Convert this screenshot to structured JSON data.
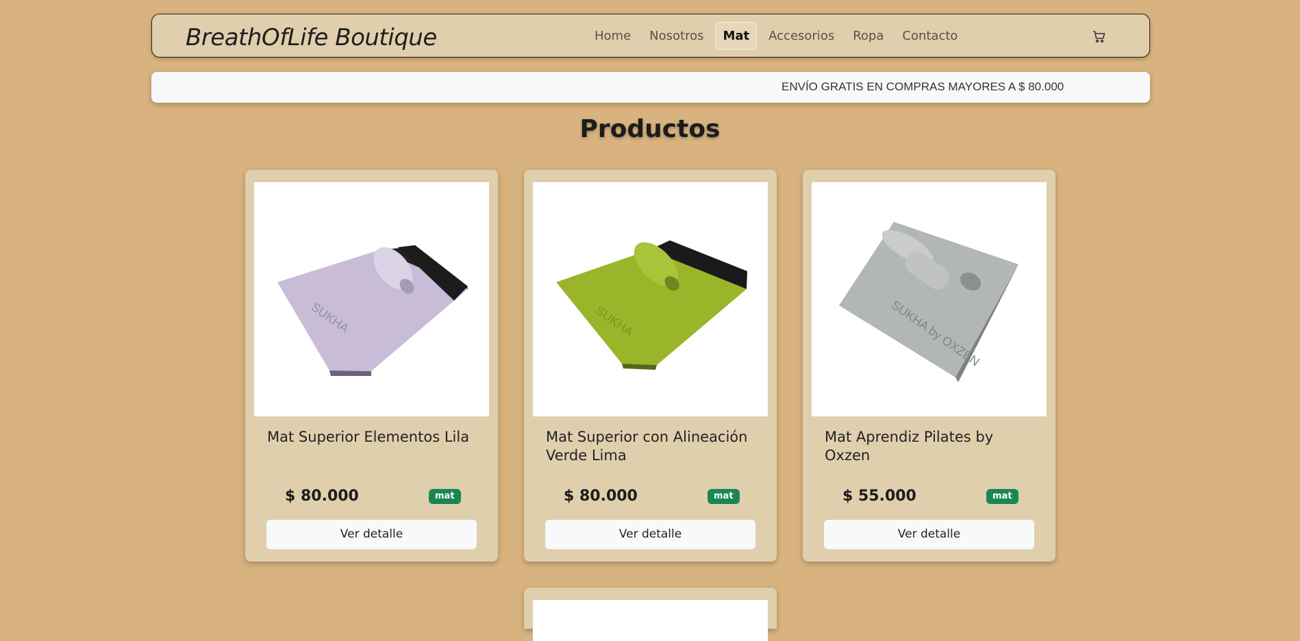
{
  "brand": "BreathOfLife Boutique",
  "nav": {
    "links": [
      "Home",
      "Nosotros",
      "Mat",
      "Accesorios",
      "Ropa",
      "Contacto"
    ],
    "active": "Mat",
    "cart_icon": "cart-icon"
  },
  "banner": {
    "text": "ENVÍO GRATIS EN COMPRAS MAYORES A $ 80.000"
  },
  "page_title": "Productos",
  "products": [
    {
      "title": "Mat Superior Elementos Lila",
      "price": "$ 80.000",
      "category": "mat",
      "button": "Ver detalle",
      "mat_color": "#c8bcd6",
      "image_text": "SUKHA"
    },
    {
      "title": "Mat Superior con Alineación Verde Lima",
      "price": "$ 80.000",
      "category": "mat",
      "button": "Ver detalle",
      "mat_color": "#9ab529",
      "image_text": "SUKHA"
    },
    {
      "title": "Mat Aprendiz Pilates by Oxzen",
      "price": "$ 55.000",
      "category": "mat",
      "button": "Ver detalle",
      "mat_color": "#b3b6b7",
      "image_text": "SUKHA by OXZEN"
    }
  ],
  "colors": {
    "background": "#d8b37f",
    "card": "#e0cfad",
    "badge": "#198754"
  }
}
